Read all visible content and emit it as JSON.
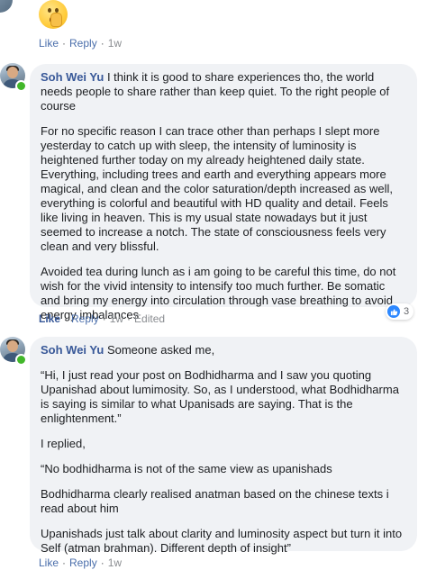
{
  "comment0": {
    "actions": {
      "like": "Like",
      "reply": "Reply",
      "time": "1w"
    }
  },
  "comment1": {
    "author": "Soh Wei Yu",
    "paragraphs": [
      "I think it is good to share experiences tho, the world needs people to share rather than keep quiet. To the right people of course",
      "For no specific reason I can trace other than perhaps I slept more yesterday to catch up with sleep, the intensity of luminosity is heightened further today on my already heightened daily state. Everything, including trees and earth and everything appears more magical, and clean and the color saturation/depth increased as well, everything is colorful and beautiful with HD quality and detail. Feels like living in heaven. This is my usual state nowadays but it just seemed to increase a notch. The state of consciousness feels very clean and very blissful.",
      "Avoided tea during lunch as i am going to be careful this time, do not wish for the vivid intensity to intensify too much further. Be somatic and bring my energy into circulation through vase breathing to avoid energy imbalances"
    ],
    "reaction_count": "3",
    "actions": {
      "like": "Like",
      "reply": "Reply",
      "time": "1w",
      "edited": "Edited"
    }
  },
  "comment2": {
    "author": "Soh Wei Yu",
    "paragraphs": [
      "Someone asked me,",
      "“Hi, I just read your post on Bodhidharma and I saw you quoting Upanishad about lumimosity. So, as I understood, what Bodhidharma is saying is similar to what Upanisads are saying. That is the enlightenment.”",
      "I replied,",
      "“No bodhidharma is not of the same view as upanishads",
      "Bodhidharma clearly realised anatman based on the chinese texts i read about him",
      "Upanishads just talk about clarity and luminosity aspect but turn it into Self (atman brahman). Different depth of insight”"
    ],
    "actions": {
      "like": "Like",
      "reply": "Reply",
      "time": "1w"
    }
  }
}
